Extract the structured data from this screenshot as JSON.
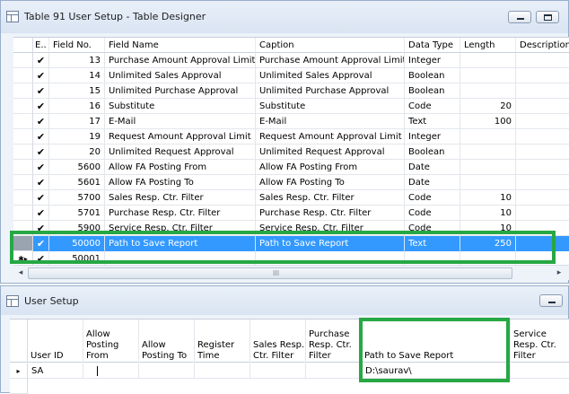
{
  "window1": {
    "title": "Table 91 User Setup - Table Designer",
    "columns": {
      "enabled": "E..",
      "field_no": "Field No.",
      "field_name": "Field Name",
      "caption": "Caption",
      "data_type": "Data Type",
      "length": "Length",
      "description": "Description"
    },
    "rows": [
      {
        "checked": "✔",
        "field_no": "13",
        "field_name": "Purchase Amount Approval Limit",
        "caption": "Purchase Amount Approval Limit",
        "data_type": "Integer",
        "length": ""
      },
      {
        "checked": "✔",
        "field_no": "14",
        "field_name": "Unlimited Sales Approval",
        "caption": "Unlimited Sales Approval",
        "data_type": "Boolean",
        "length": ""
      },
      {
        "checked": "✔",
        "field_no": "15",
        "field_name": "Unlimited Purchase Approval",
        "caption": "Unlimited Purchase Approval",
        "data_type": "Boolean",
        "length": ""
      },
      {
        "checked": "✔",
        "field_no": "16",
        "field_name": "Substitute",
        "caption": "Substitute",
        "data_type": "Code",
        "length": "20"
      },
      {
        "checked": "✔",
        "field_no": "17",
        "field_name": "E-Mail",
        "caption": "E-Mail",
        "data_type": "Text",
        "length": "100"
      },
      {
        "checked": "✔",
        "field_no": "19",
        "field_name": "Request Amount Approval Limit",
        "caption": "Request Amount Approval Limit",
        "data_type": "Integer",
        "length": ""
      },
      {
        "checked": "✔",
        "field_no": "20",
        "field_name": "Unlimited Request Approval",
        "caption": "Unlimited Request Approval",
        "data_type": "Boolean",
        "length": ""
      },
      {
        "checked": "✔",
        "field_no": "5600",
        "field_name": "Allow FA Posting From",
        "caption": "Allow FA Posting From",
        "data_type": "Date",
        "length": ""
      },
      {
        "checked": "✔",
        "field_no": "5601",
        "field_name": "Allow FA Posting To",
        "caption": "Allow FA Posting To",
        "data_type": "Date",
        "length": ""
      },
      {
        "checked": "✔",
        "field_no": "5700",
        "field_name": "Sales Resp. Ctr. Filter",
        "caption": "Sales Resp. Ctr. Filter",
        "data_type": "Code",
        "length": "10"
      },
      {
        "checked": "✔",
        "field_no": "5701",
        "field_name": "Purchase Resp. Ctr. Filter",
        "caption": "Purchase Resp. Ctr. Filter",
        "data_type": "Code",
        "length": "10"
      },
      {
        "checked": "✔",
        "field_no": "5900",
        "field_name": "Service Resp. Ctr. Filter",
        "caption": "Service Resp. Ctr. Filter",
        "data_type": "Code",
        "length": "10"
      }
    ],
    "selected_row": {
      "checked": "✔",
      "field_no": "50000",
      "field_name": "Path to Save Report",
      "caption": "Path to Save Report",
      "data_type": "Text",
      "length": "250"
    },
    "new_row": {
      "marker": "✱▸",
      "checked": "✔",
      "field_no": "50001"
    },
    "scroll_grip": "III",
    "left_arrow": "◂",
    "right_arrow": "▸"
  },
  "window2": {
    "title": "User Setup",
    "columns": [
      "User ID",
      "Allow\nPosting\nFrom",
      "Allow\nPosting To",
      "Register\nTime",
      "Sales Resp.\nCtr. Filter",
      "Purchase\nResp. Ctr.\nFilter",
      "Path to Save Report",
      "Service\nResp. Ctr.\nFilter"
    ],
    "row": {
      "marker": "▸",
      "user_id": "SA",
      "path_to_save_report": "D:\\saurav\\"
    }
  },
  "colors": {
    "selection": "#3399ff",
    "highlight": "#27a844",
    "window_bg": "#eef3fa"
  }
}
